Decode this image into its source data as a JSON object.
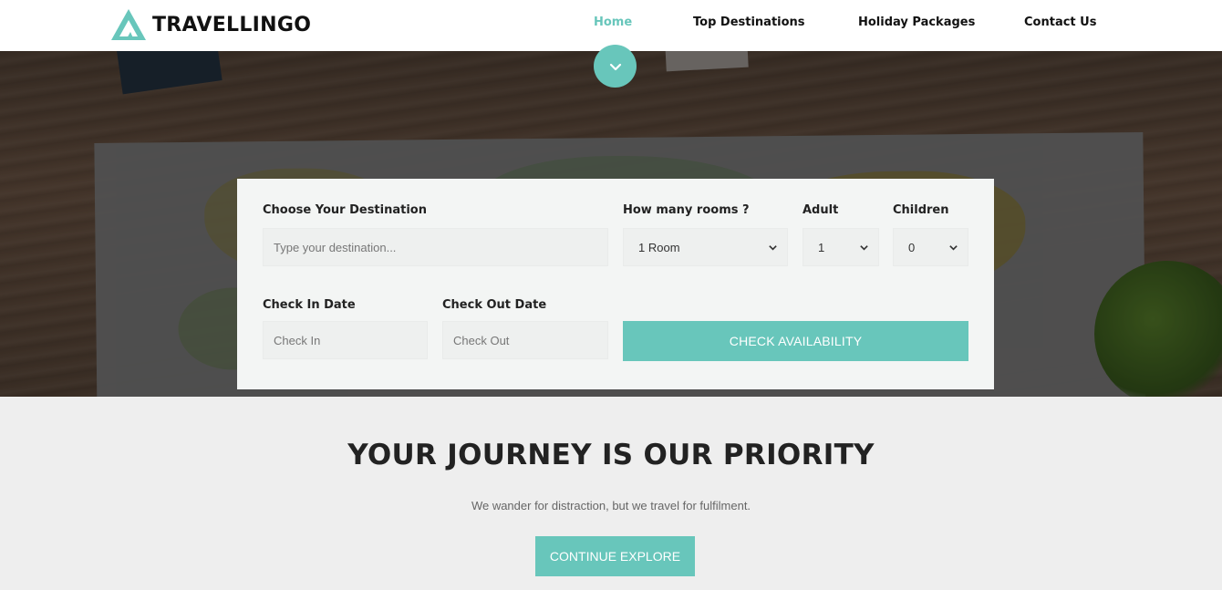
{
  "brand": {
    "name": "TRAVELLINGO",
    "accent_color": "#68c6bb"
  },
  "nav": {
    "items": [
      {
        "label": "Home",
        "active": true
      },
      {
        "label": "Top Destinations",
        "active": false
      },
      {
        "label": "Holiday Packages",
        "active": false
      },
      {
        "label": "Contact Us",
        "active": false
      }
    ]
  },
  "hero": {
    "scroll_icon": "chevron-down-icon"
  },
  "booking": {
    "destination_label": "Choose Your Destination",
    "destination_placeholder": "Type your destination...",
    "rooms_label": "How many rooms ?",
    "rooms_value": "1 Room",
    "adult_label": "Adult",
    "adult_value": "1",
    "children_label": "Children",
    "children_value": "0",
    "checkin_label": "Check In Date",
    "checkin_placeholder": "Check In",
    "checkout_label": "Check Out Date",
    "checkout_placeholder": "Check Out",
    "submit_label": "CHECK AVAILABILITY"
  },
  "intro": {
    "headline_pre": "YOUR ",
    "headline_bold": "JOURNEY",
    "headline_post": " IS OUR PRIORITY",
    "subline": "We wander for distraction, but we travel for fulfilment.",
    "cta_label": "CONTINUE EXPLORE"
  }
}
